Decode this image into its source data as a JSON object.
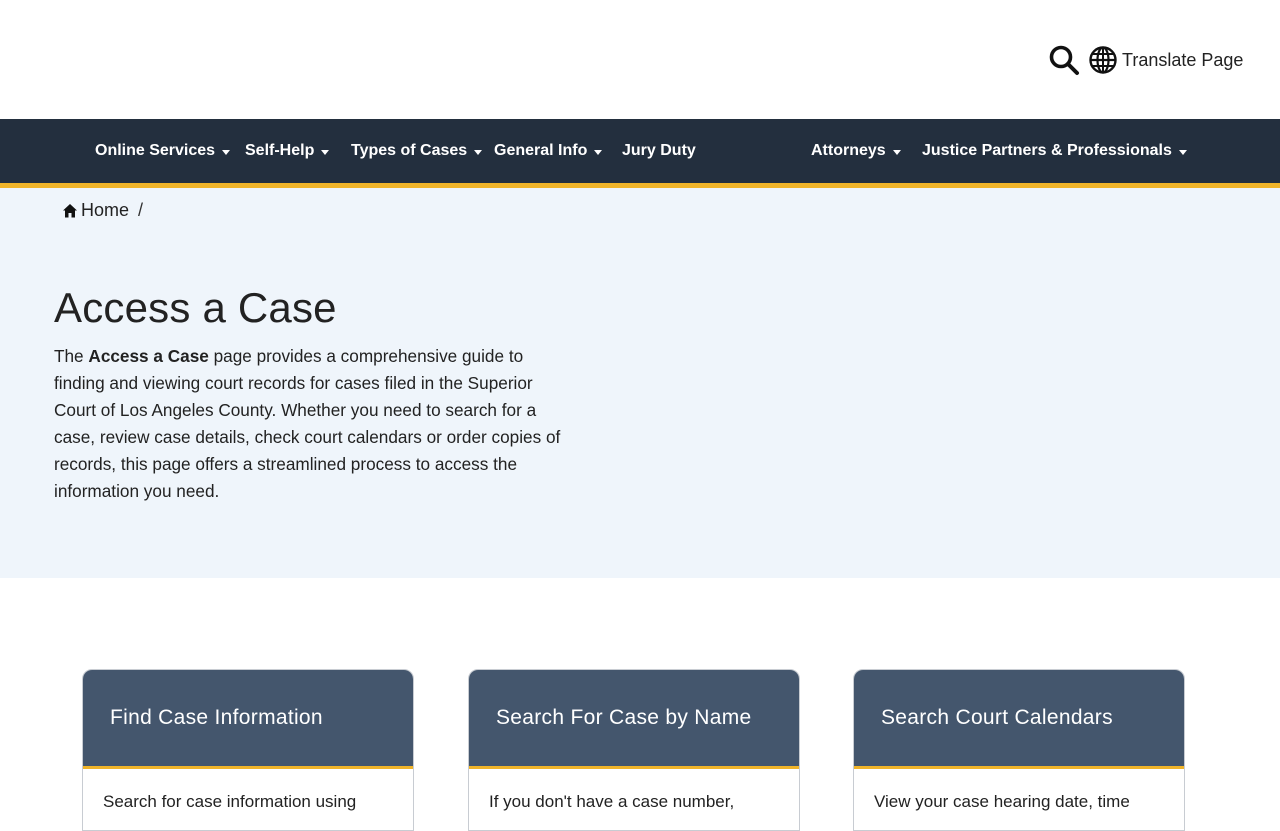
{
  "header": {
    "translate_label": "Translate Page"
  },
  "nav": {
    "items": [
      {
        "label": "Online Services",
        "dropdown": true
      },
      {
        "label": "Self-Help",
        "dropdown": true
      },
      {
        "label": "Types of Cases",
        "dropdown": true
      },
      {
        "label": "General Info",
        "dropdown": true
      },
      {
        "label": "Jury Duty",
        "dropdown": false
      },
      {
        "label": "Attorneys",
        "dropdown": true
      },
      {
        "label": "Justice Partners & Professionals",
        "dropdown": true
      }
    ]
  },
  "breadcrumb": {
    "home": "Home",
    "separator": "/"
  },
  "page": {
    "title": "Access a Case",
    "intro_pre": "The ",
    "intro_bold": "Access a Case",
    "intro_post": " page provides a comprehensive guide to finding and viewing court records for cases filed in the Superior Court of Los Angeles County. Whether you need to search for a case, review case details, check court calendars or order copies of records, this page offers a streamlined process to access the information you need."
  },
  "cards": [
    {
      "title": "Find Case Information",
      "body": "Search for case information using"
    },
    {
      "title": "Search For Case by Name",
      "body": "If you don't have a case number,"
    },
    {
      "title": "Search Court Calendars",
      "body": "View your case hearing date, time"
    }
  ],
  "colors": {
    "nav_bg": "#232f3e",
    "accent": "#f0b429",
    "hero_bg": "#eff5fb",
    "card_head": "#44566d"
  }
}
